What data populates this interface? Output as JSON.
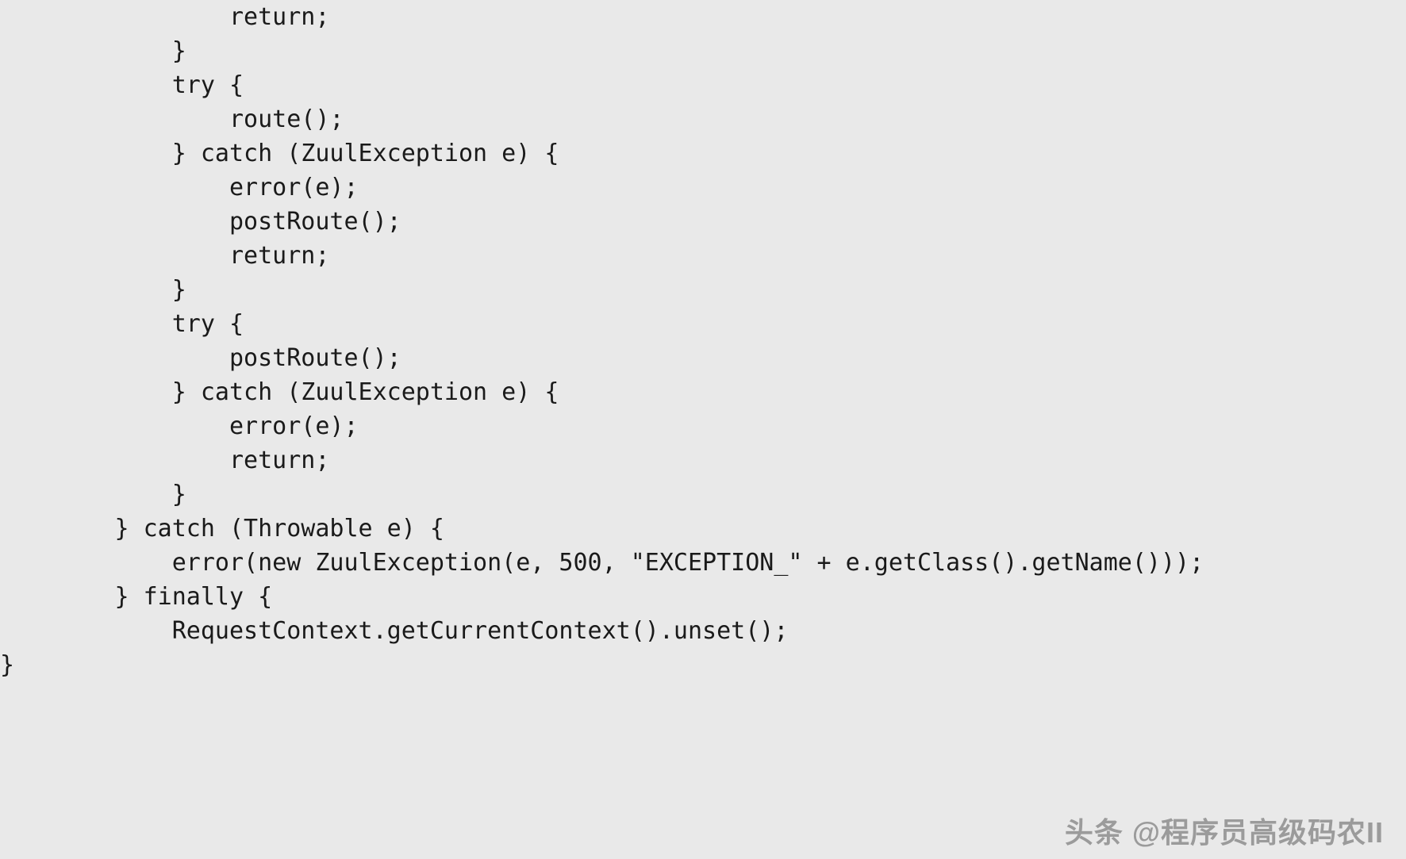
{
  "code": {
    "lines": [
      "                return;",
      "            }",
      "            try {",
      "                route();",
      "            } catch (ZuulException e) {",
      "                error(e);",
      "                postRoute();",
      "                return;",
      "            }",
      "            try {",
      "                postRoute();",
      "            } catch (ZuulException e) {",
      "                error(e);",
      "                return;",
      "            }",
      "        } catch (Throwable e) {",
      "            error(new ZuulException(e, 500, \"EXCEPTION_\" + e.getClass().getName()));",
      "        } finally {",
      "            RequestContext.getCurrentContext().unset();",
      "}"
    ]
  },
  "watermark": "头条 @程序员高级码农II"
}
